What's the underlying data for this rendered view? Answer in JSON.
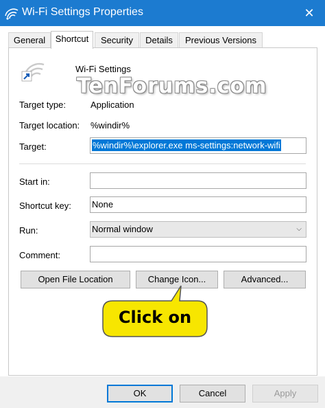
{
  "window": {
    "title": "Wi-Fi Settings Properties",
    "close_glyph": "✕",
    "accent_color": "#1c7bd0"
  },
  "tabs": [
    {
      "label": "General",
      "active": false
    },
    {
      "label": "Shortcut",
      "active": true
    },
    {
      "label": "Security",
      "active": false
    },
    {
      "label": "Details",
      "active": false
    },
    {
      "label": "Previous Versions",
      "active": false
    }
  ],
  "shortcut": {
    "icon": "wifi-shortcut-icon",
    "name": "Wi-Fi Settings",
    "target_type_label": "Target type:",
    "target_type_value": "Application",
    "target_location_label": "Target location:",
    "target_location_value": "%windir%",
    "target_label": "Target:",
    "target_value": "%windir%\\explorer.exe ms-settings:network-wifi",
    "start_in_label": "Start in:",
    "start_in_value": "",
    "shortcut_key_label": "Shortcut key:",
    "shortcut_key_value": "None",
    "run_label": "Run:",
    "run_value": "Normal window",
    "comment_label": "Comment:",
    "comment_value": ""
  },
  "actions": {
    "open_file_location": "Open File Location",
    "change_icon": "Change Icon...",
    "advanced": "Advanced..."
  },
  "footer": {
    "ok": "OK",
    "cancel": "Cancel",
    "apply": "Apply"
  },
  "watermark": "TenForums.com",
  "callout": {
    "text": "Click on",
    "fill_color": "#f7e600"
  }
}
